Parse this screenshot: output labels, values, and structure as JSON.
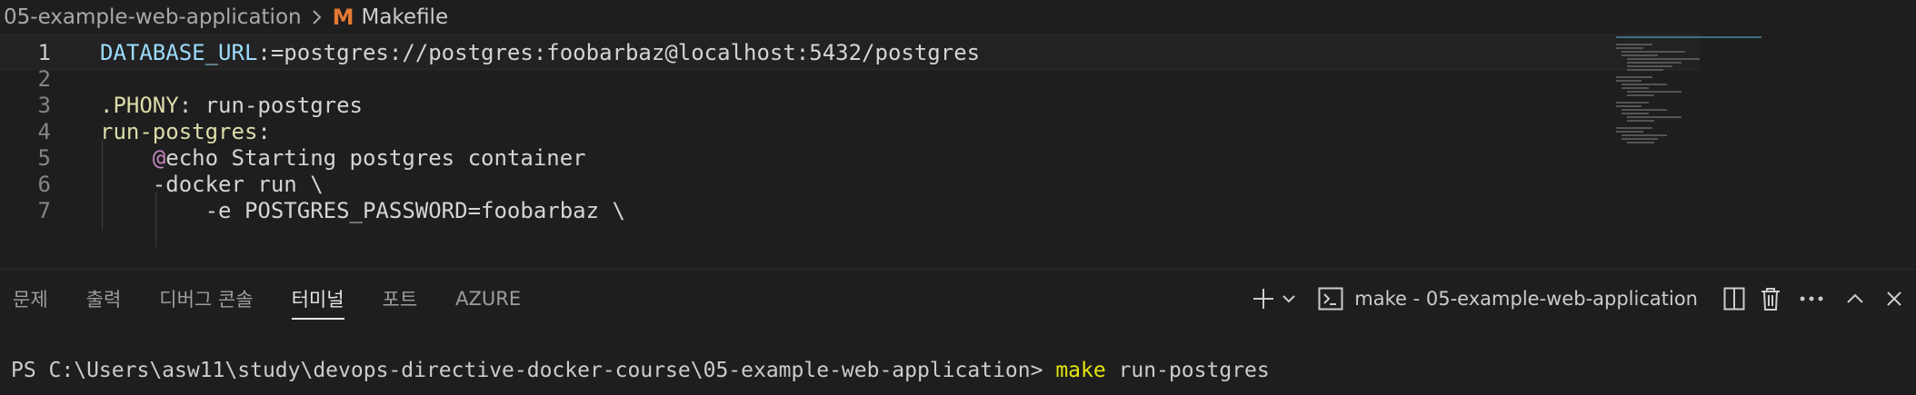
{
  "breadcrumb": {
    "folder": "05-example-web-application",
    "file_icon": "M",
    "file": "Makefile"
  },
  "editor": {
    "lines": [
      {
        "n": "1",
        "parts": [
          {
            "t": "DATABASE_URL",
            "c": "var"
          },
          {
            "t": ":=postgres://postgres:foobarbaz@localhost:5432/postgres",
            "c": "plain"
          }
        ]
      },
      {
        "n": "2",
        "parts": []
      },
      {
        "n": "3",
        "parts": [
          {
            "t": ".PHONY",
            "c": "target"
          },
          {
            "t": ": run-postgres",
            "c": "plain"
          }
        ]
      },
      {
        "n": "4",
        "parts": [
          {
            "t": "run-postgres",
            "c": "target"
          },
          {
            "t": ":",
            "c": "plain"
          }
        ]
      },
      {
        "n": "5",
        "parts": [
          {
            "t": "    ",
            "c": "plain"
          },
          {
            "t": "@",
            "c": "kw"
          },
          {
            "t": "echo Starting postgres container",
            "c": "plain"
          }
        ]
      },
      {
        "n": "6",
        "parts": [
          {
            "t": "    -docker run \\",
            "c": "plain"
          }
        ]
      },
      {
        "n": "7",
        "parts": [
          {
            "t": "        -e POSTGRES_PASSWORD=foobarbaz \\",
            "c": "plain"
          }
        ]
      }
    ]
  },
  "panel": {
    "tabs": [
      "문제",
      "출력",
      "디버그 콘솔",
      "터미널",
      "포트",
      "AZURE"
    ],
    "active_tab": 3,
    "terminal_name": "make - 05-example-web-application",
    "icons": [
      "plus-icon",
      "chevron-down-icon",
      "terminal-icon",
      "split-icon",
      "trash-icon",
      "more-icon",
      "chevron-up-icon",
      "close-icon"
    ]
  },
  "terminal": {
    "prompt": "PS C:\\Users\\asw11\\study\\devops-directive-docker-course\\05-example-web-application> ",
    "command": "make",
    "args": " run-postgres"
  },
  "colors": {
    "background": "#1e1e1e",
    "variable": "#9cdcfe",
    "target": "#dcdcaa",
    "keyword": "#c586c0",
    "makefile_icon": "#e37933",
    "terminal_command": "#e5e510"
  }
}
